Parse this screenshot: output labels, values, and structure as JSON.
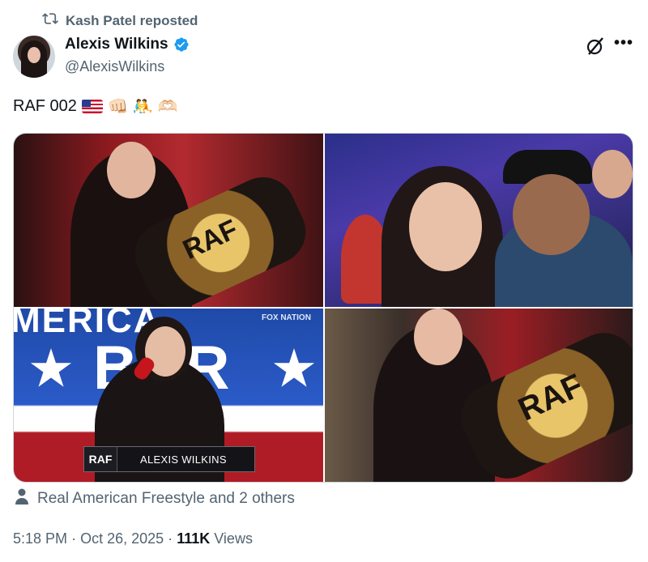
{
  "repost": {
    "label": "Kash Patel reposted"
  },
  "author": {
    "name": "Alexis Wilkins",
    "handle": "@AlexisWilkins",
    "verified": true
  },
  "tweet": {
    "text": "RAF 002",
    "emojis": [
      "🇺🇸",
      "👊🏻",
      "🤼",
      "🫶🏻"
    ]
  },
  "media": {
    "image1": {
      "belt_text": "RAF"
    },
    "image3": {
      "banner_text": "BER",
      "banner_top": "MERICA",
      "network_logo": "FOX NATION",
      "lower_third_logo": "RAF",
      "lower_third_name": "ALEXIS WILKINS"
    },
    "image4": {
      "belt_text": "RAF"
    }
  },
  "tagged": {
    "label": "Real American Freestyle and 2 others"
  },
  "meta": {
    "time": "5:18 PM",
    "sep1": "·",
    "date": "Oct 26, 2025",
    "sep2": "·",
    "views_count": "111K",
    "views_label": "Views"
  },
  "colors": {
    "text_primary": "#0f1419",
    "text_secondary": "#536471",
    "verified": "#1d9bf0"
  },
  "icons": [
    "repost-icon",
    "verified-icon",
    "grok-icon",
    "more-icon",
    "person-icon"
  ]
}
